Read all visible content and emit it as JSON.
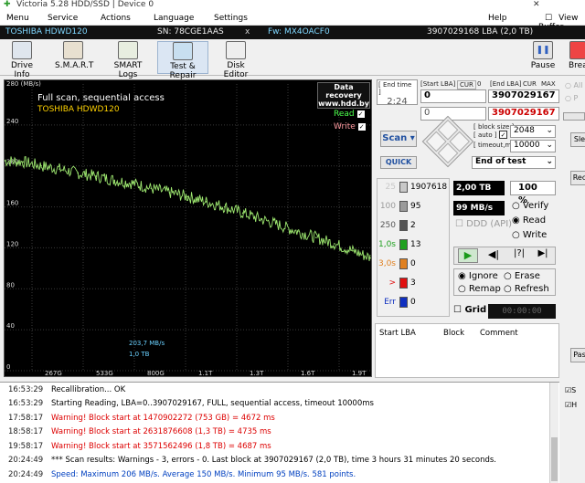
{
  "titlebar": {
    "title": "Victoria 5.28 HDD/SSD | Device 0",
    "close": "✕",
    "view_buffer": "View Buffer"
  },
  "menu": [
    "Menu",
    "Service",
    "Actions",
    "Language",
    "Settings",
    "Help"
  ],
  "drive": {
    "model": "TOSHIBA HDWD120",
    "sn": "SN: 78CGE1AAS",
    "x": "x",
    "fw": "Fw: MX4OACF0",
    "lba": "3907029168 LBA (2,0 TB)"
  },
  "toolbar": {
    "drive_info": "Drive Info",
    "smart": "S.M.A.R.T",
    "smart_logs": "SMART Logs",
    "test_repair": "Test & Repair",
    "disk_editor": "Disk Editor",
    "pause": "Pause",
    "break": "Brea"
  },
  "graph": {
    "ylabel_top": "280 (MB/s)",
    "ticks_y": [
      "240",
      "200",
      "160",
      "120",
      "80",
      "40",
      "0"
    ],
    "ticks_x": [
      "267G",
      "533G",
      "800G",
      "1.1T",
      "1.3T",
      "1.6T",
      "1.9T"
    ],
    "title": "Full scan, sequential access",
    "model": "TOSHIBA HDWD120",
    "recovery1": "Data recovery",
    "recovery2": "www.hdd.by",
    "read": "Read",
    "write": "Write",
    "speed_label": "203,7 MB/s",
    "pos_label": "1,0 TB",
    "colors": {
      "line": "#9ee870",
      "grid": "#3a3a3a"
    }
  },
  "chart_data": {
    "type": "line",
    "title": "Full scan, sequential access",
    "xlabel": "",
    "ylabel": "MB/s",
    "ylim": [
      0,
      280
    ],
    "x_tick_labels": [
      "267G",
      "533G",
      "800G",
      "1.1T",
      "1.3T",
      "1.6T",
      "1.9T"
    ],
    "series": [
      {
        "name": "Read",
        "x": [
          0,
          0.1,
          0.2,
          0.3,
          0.4,
          0.5,
          0.6,
          0.7,
          0.8,
          0.9,
          1.0,
          1.1,
          1.2,
          1.3,
          1.4,
          1.5,
          1.6,
          1.7,
          1.8,
          1.9,
          2.0
        ],
        "values": [
          205,
          204,
          200,
          197,
          193,
          190,
          186,
          183,
          178,
          174,
          170,
          165,
          160,
          154,
          148,
          142,
          136,
          130,
          124,
          117,
          110
        ]
      }
    ]
  },
  "controls": {
    "end_time_label": "[ End time ]",
    "end_time": "2:24",
    "start_lba_label": "[Start LBA]",
    "cur_label": "CUR",
    "zero": "0",
    "end_lba_label": "[End LBA]",
    "cur2": "CUR",
    "max": "MAX",
    "start_lba": "0",
    "end_lba": "3907029167",
    "cur_lba": "0",
    "cur_end": "3907029167",
    "scan": "Scan ▾",
    "quick": "QUICK",
    "block_size_label": "[ block size ]",
    "auto": "[ auto ]",
    "block_size": "2048",
    "timeout_label": "[ timeout,ms ]",
    "timeout": "10000",
    "end_of_test": "End of test"
  },
  "stats": [
    {
      "ms": "25",
      "count": "1907618",
      "color": "#c8c8c8"
    },
    {
      "ms": "100",
      "count": "95",
      "color": "#9a9a9a"
    },
    {
      "ms": "250",
      "count": "2",
      "color": "#555555"
    },
    {
      "ms": "1,0s",
      "count": "13",
      "color": "#1fa01f"
    },
    {
      "ms": "3,0s",
      "count": "0",
      "color": "#e08020"
    },
    {
      "ms": ">",
      "count": "3",
      "color": "#e01010"
    },
    {
      "ms": "Err",
      "count": "0",
      "color": "#1030c0"
    }
  ],
  "status": {
    "size": "2,00 TB",
    "percent": "100",
    "pct_sign": "%",
    "speed": "99 MB/s",
    "ddd": "DDD (API)",
    "verify": "Verify",
    "read": "Read",
    "write": "Write",
    "ignore": "Ignore",
    "erase": "Erase",
    "remap": "Remap",
    "refresh": "Refresh",
    "grid": "Grid",
    "grid_time": "00:00:00"
  },
  "table": {
    "col1": "Start LBA",
    "col2": "Block",
    "col3": "Comment"
  },
  "right_panel": {
    "all": "All",
    "p": "P",
    "sle": "Sle",
    "rec": "Rec",
    "pas": "Pas",
    "s": "S",
    "h": "H"
  },
  "log": [
    {
      "time": "16:53:29",
      "msg": "Recallibration... OK",
      "cls": ""
    },
    {
      "time": "16:53:29",
      "msg": "Starting Reading, LBA=0..3907029167, FULL, sequential access, timeout 10000ms",
      "cls": ""
    },
    {
      "time": "17:58:17",
      "msg": "Warning! Block start at 1470902272 (753 GB)  = 4672 ms",
      "cls": "warn"
    },
    {
      "time": "18:58:17",
      "msg": "Warning! Block start at 2631876608 (1,3 TB)  = 4735 ms",
      "cls": "warn"
    },
    {
      "time": "19:58:17",
      "msg": "Warning! Block start at 3571562496 (1,8 TB)  = 4687 ms",
      "cls": "warn"
    },
    {
      "time": "20:24:49",
      "msg": "*** Scan results: Warnings - 3, errors - 0. Last block at 3907029167 (2,0 TB), time 3 hours 31 minutes 20 seconds.",
      "cls": ""
    },
    {
      "time": "20:24:49",
      "msg": "Speed: Maximum 206 MB/s. Average 150 MB/s. Minimum 95 MB/s. 581 points.",
      "cls": "ok"
    }
  ]
}
